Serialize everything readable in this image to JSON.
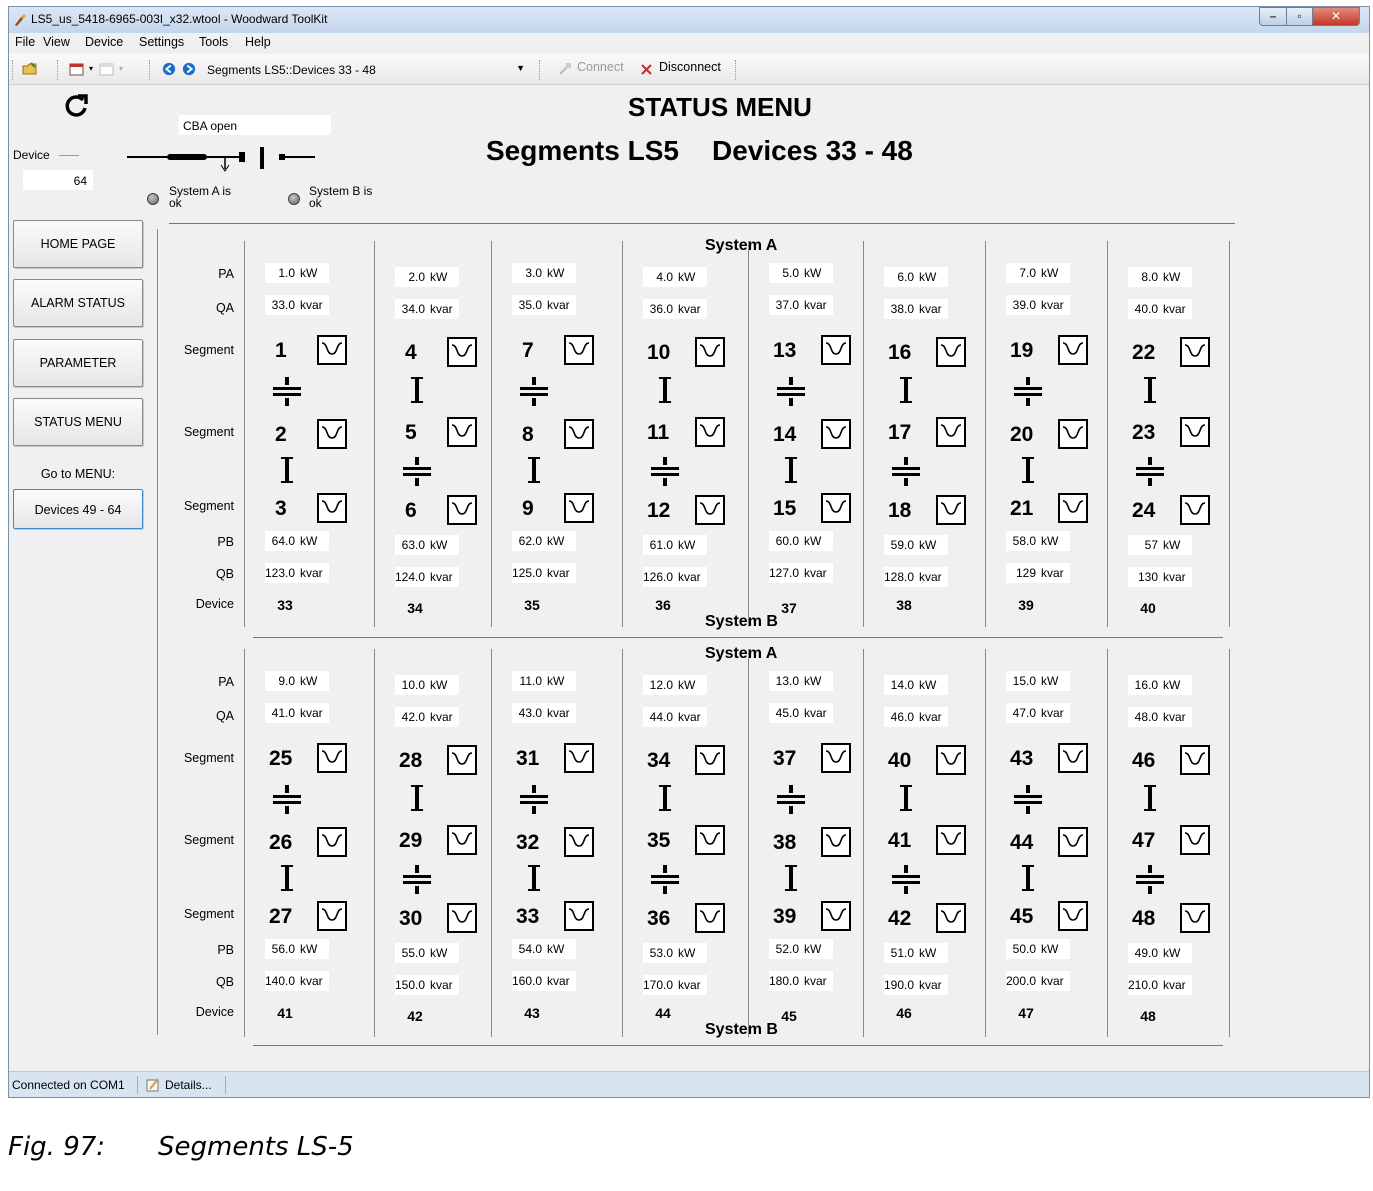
{
  "window": {
    "title": "LS5_us_5418-6965-003I_x32.wtool - Woodward ToolKit"
  },
  "menu": [
    "File",
    "View",
    "Device",
    "Settings",
    "Tools",
    "Help"
  ],
  "toolbar": {
    "combo_value": "Segments LS5::Devices 33 - 48",
    "connect": "Connect",
    "disconnect": "Disconnect"
  },
  "header": {
    "title": "STATUS MENU",
    "subtitle_left": "Segments LS5",
    "subtitle_right": "Devices 33 - 48"
  },
  "cba_status": "CBA open",
  "device_label": "Device",
  "device_value": "64",
  "system_a_status": [
    "System A is",
    "ok"
  ],
  "system_b_status": [
    "System B is",
    "ok"
  ],
  "nav": {
    "home": "HOME PAGE",
    "alarm": "ALARM STATUS",
    "parameter": "PARAMETER",
    "status": "STATUS MENU",
    "goto": "Go to MENU:",
    "devices_next": "Devices 49 - 64"
  },
  "labels": {
    "pa": "PA",
    "qa": "QA",
    "segment": "Segment",
    "pb": "PB",
    "qb": "QB",
    "device": "Device",
    "system_a": "System A",
    "system_b": "System B",
    "kw": "kW",
    "kvar": "kvar"
  },
  "blocks": [
    {
      "columns": [
        {
          "pa": "1.0",
          "qa": "33.0",
          "segs": [
            "1",
            "2",
            "3"
          ],
          "breakers": [
            "open",
            "closed"
          ],
          "pb": "64.0",
          "qb": "123.0",
          "device": "33"
        },
        {
          "pa": "2.0",
          "qa": "34.0",
          "segs": [
            "4",
            "5",
            "6"
          ],
          "breakers": [
            "closed",
            "open"
          ],
          "pb": "63.0",
          "qb": "124.0",
          "device": "34"
        },
        {
          "pa": "3.0",
          "qa": "35.0",
          "segs": [
            "7",
            "8",
            "9"
          ],
          "breakers": [
            "open",
            "closed"
          ],
          "pb": "62.0",
          "qb": "125.0",
          "device": "35"
        },
        {
          "pa": "4.0",
          "qa": "36.0",
          "segs": [
            "10",
            "11",
            "12"
          ],
          "breakers": [
            "closed",
            "open"
          ],
          "pb": "61.0",
          "qb": "126.0",
          "device": "36"
        },
        {
          "pa": "5.0",
          "qa": "37.0",
          "segs": [
            "13",
            "14",
            "15"
          ],
          "breakers": [
            "open",
            "closed"
          ],
          "pb": "60.0",
          "qb": "127.0",
          "device": "37"
        },
        {
          "pa": "6.0",
          "qa": "38.0",
          "segs": [
            "16",
            "17",
            "18"
          ],
          "breakers": [
            "closed",
            "open"
          ],
          "pb": "59.0",
          "qb": "128.0",
          "device": "38"
        },
        {
          "pa": "7.0",
          "qa": "39.0",
          "segs": [
            "19",
            "20",
            "21"
          ],
          "breakers": [
            "open",
            "closed"
          ],
          "pb": "58.0",
          "qb": "129",
          "device": "39"
        },
        {
          "pa": "8.0",
          "qa": "40.0",
          "segs": [
            "22",
            "23",
            "24"
          ],
          "breakers": [
            "closed",
            "open"
          ],
          "pb": "57",
          "qb": "130",
          "device": "40"
        }
      ]
    },
    {
      "columns": [
        {
          "pa": "9.0",
          "qa": "41.0",
          "segs": [
            "25",
            "26",
            "27"
          ],
          "breakers": [
            "open",
            "closed"
          ],
          "pb": "56.0",
          "qb": "140.0",
          "device": "41"
        },
        {
          "pa": "10.0",
          "qa": "42.0",
          "segs": [
            "28",
            "29",
            "30"
          ],
          "breakers": [
            "closed",
            "open"
          ],
          "pb": "55.0",
          "qb": "150.0",
          "device": "42"
        },
        {
          "pa": "11.0",
          "qa": "43.0",
          "segs": [
            "31",
            "32",
            "33"
          ],
          "breakers": [
            "open",
            "closed"
          ],
          "pb": "54.0",
          "qb": "160.0",
          "device": "43"
        },
        {
          "pa": "12.0",
          "qa": "44.0",
          "segs": [
            "34",
            "35",
            "36"
          ],
          "breakers": [
            "closed",
            "open"
          ],
          "pb": "53.0",
          "qb": "170.0",
          "device": "44"
        },
        {
          "pa": "13.0",
          "qa": "45.0",
          "segs": [
            "37",
            "38",
            "39"
          ],
          "breakers": [
            "open",
            "closed"
          ],
          "pb": "52.0",
          "qb": "180.0",
          "device": "45"
        },
        {
          "pa": "14.0",
          "qa": "46.0",
          "segs": [
            "40",
            "41",
            "42"
          ],
          "breakers": [
            "closed",
            "open"
          ],
          "pb": "51.0",
          "qb": "190.0",
          "device": "46"
        },
        {
          "pa": "15.0",
          "qa": "47.0",
          "segs": [
            "43",
            "44",
            "45"
          ],
          "breakers": [
            "open",
            "closed"
          ],
          "pb": "50.0",
          "qb": "200.0",
          "device": "47"
        },
        {
          "pa": "16.0",
          "qa": "48.0",
          "segs": [
            "46",
            "47",
            "48"
          ],
          "breakers": [
            "closed",
            "open"
          ],
          "pb": "49.0",
          "qb": "210.0",
          "device": "48"
        }
      ]
    }
  ],
  "statusbar": {
    "connection": "Connected on COM1",
    "details": "Details..."
  },
  "caption": {
    "label": "Fig. 97:",
    "text": "Segments LS-5"
  }
}
